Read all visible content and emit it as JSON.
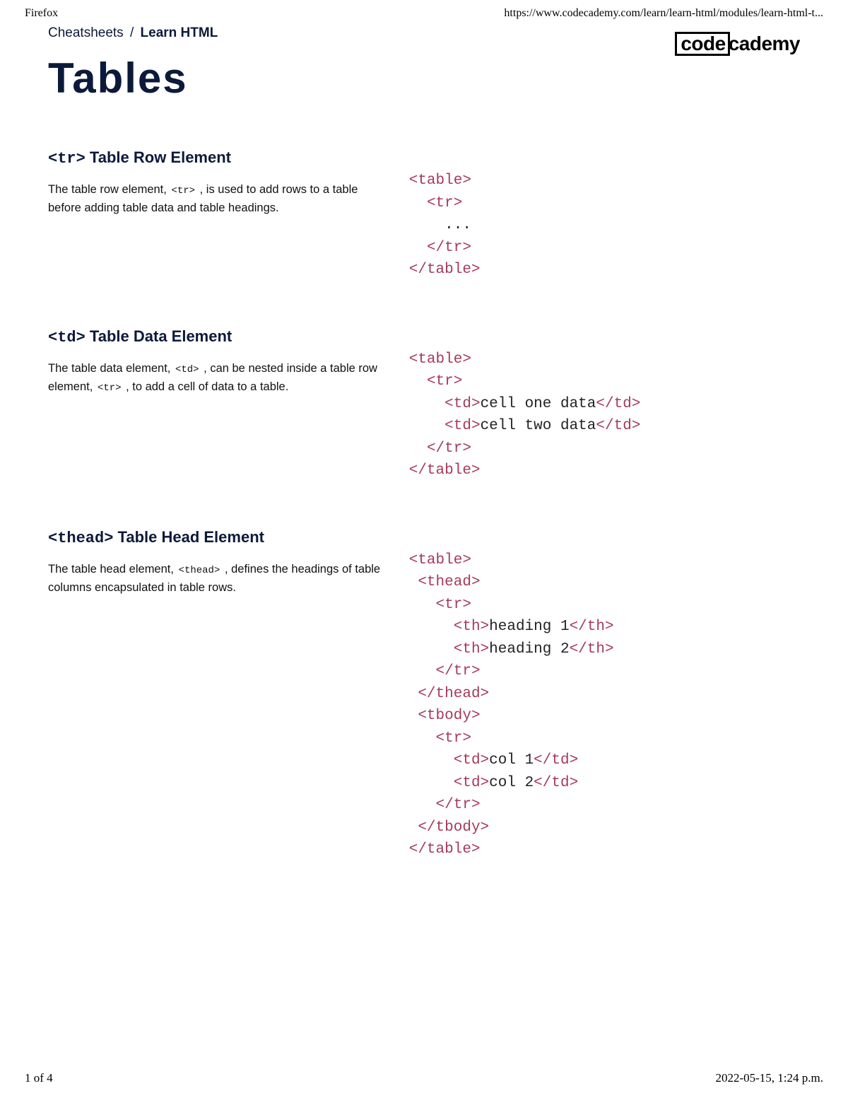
{
  "print_header": {
    "left": "Firefox",
    "right": "https://www.codecademy.com/learn/learn-html/modules/learn-html-t..."
  },
  "breadcrumb": {
    "root": "Cheatsheets",
    "sep": "/",
    "current": "Learn HTML"
  },
  "logo": {
    "box": "code",
    "rest": "cademy"
  },
  "page_title": "Tables",
  "sections": [
    {
      "title_tag": "<tr>",
      "title_rest": " Table Row Element",
      "desc_parts": [
        "The table row element, ",
        "<tr>",
        " , is used to add rows to a table before adding table data and table headings."
      ],
      "code_html": "<span class='t'>&lt;table&gt;</span>\n  <span class='t'>&lt;tr&gt;</span>\n    ...\n  <span class='t'>&lt;/tr&gt;</span>\n<span class='t'>&lt;/table&gt;</span>"
    },
    {
      "title_tag": "<td>",
      "title_rest": " Table Data Element",
      "desc_parts": [
        "The table data element, ",
        "<td>",
        " , can be nested inside a table row element, ",
        "<tr>",
        " , to add a cell of data to a table."
      ],
      "code_html": "<span class='t'>&lt;table&gt;</span>\n  <span class='t'>&lt;tr&gt;</span>\n    <span class='t'>&lt;td&gt;</span>cell one data<span class='t'>&lt;/td&gt;</span>\n    <span class='t'>&lt;td&gt;</span>cell two data<span class='t'>&lt;/td&gt;</span>\n  <span class='t'>&lt;/tr&gt;</span>\n<span class='t'>&lt;/table&gt;</span>"
    },
    {
      "title_tag": "<thead>",
      "title_rest": " Table Head Element",
      "desc_parts": [
        "The table head element, ",
        "<thead>",
        " , defines the headings of table columns encapsulated in table rows."
      ],
      "code_html": "<span class='t'>&lt;table&gt;</span>\n <span class='t'>&lt;thead&gt;</span>\n   <span class='t'>&lt;tr&gt;</span>\n     <span class='t'>&lt;th&gt;</span>heading 1<span class='t'>&lt;/th&gt;</span>\n     <span class='t'>&lt;th&gt;</span>heading 2<span class='t'>&lt;/th&gt;</span>\n   <span class='t'>&lt;/tr&gt;</span>\n <span class='t'>&lt;/thead&gt;</span>\n <span class='t'>&lt;tbody&gt;</span>\n   <span class='t'>&lt;tr&gt;</span>\n     <span class='t'>&lt;td&gt;</span>col 1<span class='t'>&lt;/td&gt;</span>\n     <span class='t'>&lt;td&gt;</span>col 2<span class='t'>&lt;/td&gt;</span>\n   <span class='t'>&lt;/tr&gt;</span>\n <span class='t'>&lt;/tbody&gt;</span>\n<span class='t'>&lt;/table&gt;</span>"
    }
  ],
  "print_footer": {
    "left": "1 of 4",
    "right": "2022-05-15, 1:24 p.m."
  }
}
